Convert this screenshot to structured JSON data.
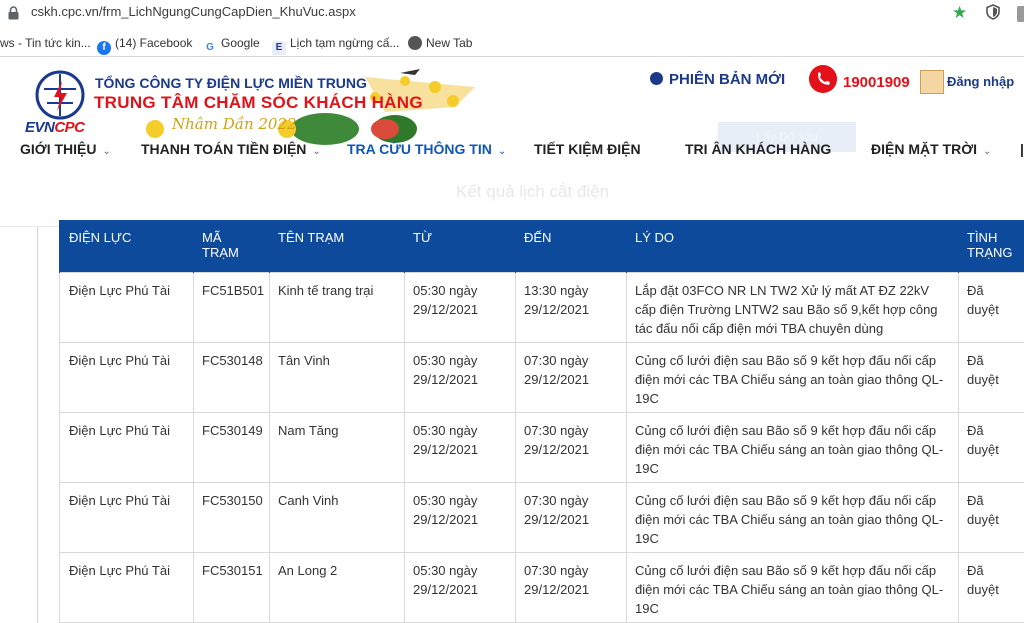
{
  "browser": {
    "url": "cskh.cpc.vn/frm_LichNgungCungCapDien_KhuVuc.aspx",
    "bookmarks": [
      {
        "label": "ws - Tin tức kin..."
      },
      {
        "label": "(14) Facebook"
      },
      {
        "label": "Google"
      },
      {
        "label": "Lịch tạm ngừng cấ..."
      },
      {
        "label": "New Tab"
      }
    ]
  },
  "site": {
    "org_line1": "TỔNG CÔNG TY ĐIỆN LỰC MIỀN TRUNG",
    "org_line2": "TRUNG TÂM CHĂM SÓC KHÁCH HÀNG",
    "logo_evn": "EVN",
    "logo_cpc": "CPC",
    "tet_greeting": "Nhâm Dần 2022",
    "new_version": "PHIÊN BẢN MỚI",
    "hotline": "19001909",
    "login": "Đăng nhập",
    "faded_button": "Lấy Dữ liệu",
    "result_title": "Kết quả lịch cắt điện"
  },
  "nav": [
    {
      "label": "GIỚI THIỆU",
      "has_menu": true
    },
    {
      "label": "THANH TOÁN TIỀN ĐIỆN",
      "has_menu": true
    },
    {
      "label": "TRA CỨU THÔNG TIN",
      "has_menu": true,
      "active": true
    },
    {
      "label": "TIẾT KIỆM ĐIỆN",
      "has_menu": false
    },
    {
      "label": "TRI ÂN KHÁCH HÀNG",
      "has_menu": false
    },
    {
      "label": "ĐIỆN MẶT TRỜI",
      "has_menu": true
    }
  ],
  "table": {
    "headers": [
      "ĐIỆN LỰC",
      "MÃ TRẠM",
      "TÊN TRẠM",
      "TỪ",
      "ĐẾN",
      "LÝ DO",
      "TÌNH TRẠNG"
    ],
    "rows": [
      [
        "Điện Lực Phú Tài",
        "FC51B501",
        "Kinh tế trang trại",
        "05:30 ngày 29/12/2021",
        "13:30 ngày 29/12/2021",
        "Lắp đặt 03FCO NR LN TW2 Xử lý mất AT ĐZ 22kV cấp điện Trường LNTW2 sau Bão số 9,kết hợp công tác đấu nối cấp điện mới TBA chuyên dùng",
        "Đã duyệt"
      ],
      [
        "Điện Lực Phú Tài",
        "FC530148",
        "Tân Vinh",
        "05:30 ngày 29/12/2021",
        "07:30 ngày 29/12/2021",
        "Củng cố lưới điện sau Bão số 9 kết hợp đấu nối cấp điện mới các TBA Chiếu sáng an toàn giao thông QL-19C",
        "Đã duyệt"
      ],
      [
        "Điện Lực Phú Tài",
        "FC530149",
        "Nam Tăng",
        "05:30 ngày 29/12/2021",
        "07:30 ngày 29/12/2021",
        "Củng cố lưới điện sau Bão số 9 kết hợp đấu nối cấp điện mới các TBA Chiếu sáng an toàn giao thông QL-19C",
        "Đã duyệt"
      ],
      [
        "Điện Lực Phú Tài",
        "FC530150",
        "Canh Vinh",
        "05:30 ngày 29/12/2021",
        "07:30 ngày 29/12/2021",
        "Củng cố lưới điện sau Bão số 9 kết hợp đấu nối cấp điện mới các TBA Chiếu sáng an toàn giao thông QL-19C",
        "Đã duyệt"
      ],
      [
        "Điện Lực Phú Tài",
        "FC530151",
        "An Long 2",
        "05:30 ngày 29/12/2021",
        "07:30 ngày 29/12/2021",
        "Củng cố lưới điện sau Bão số 9 kết hợp đấu nối cấp điện mới các TBA Chiếu sáng an toàn giao thông QL-19C",
        "Đã duyệt"
      ]
    ]
  },
  "colors": {
    "brand_blue": "#1a3a8f",
    "brand_red": "#e3121a",
    "table_header": "#0e4a9c",
    "nav_active": "#0f57b5"
  }
}
